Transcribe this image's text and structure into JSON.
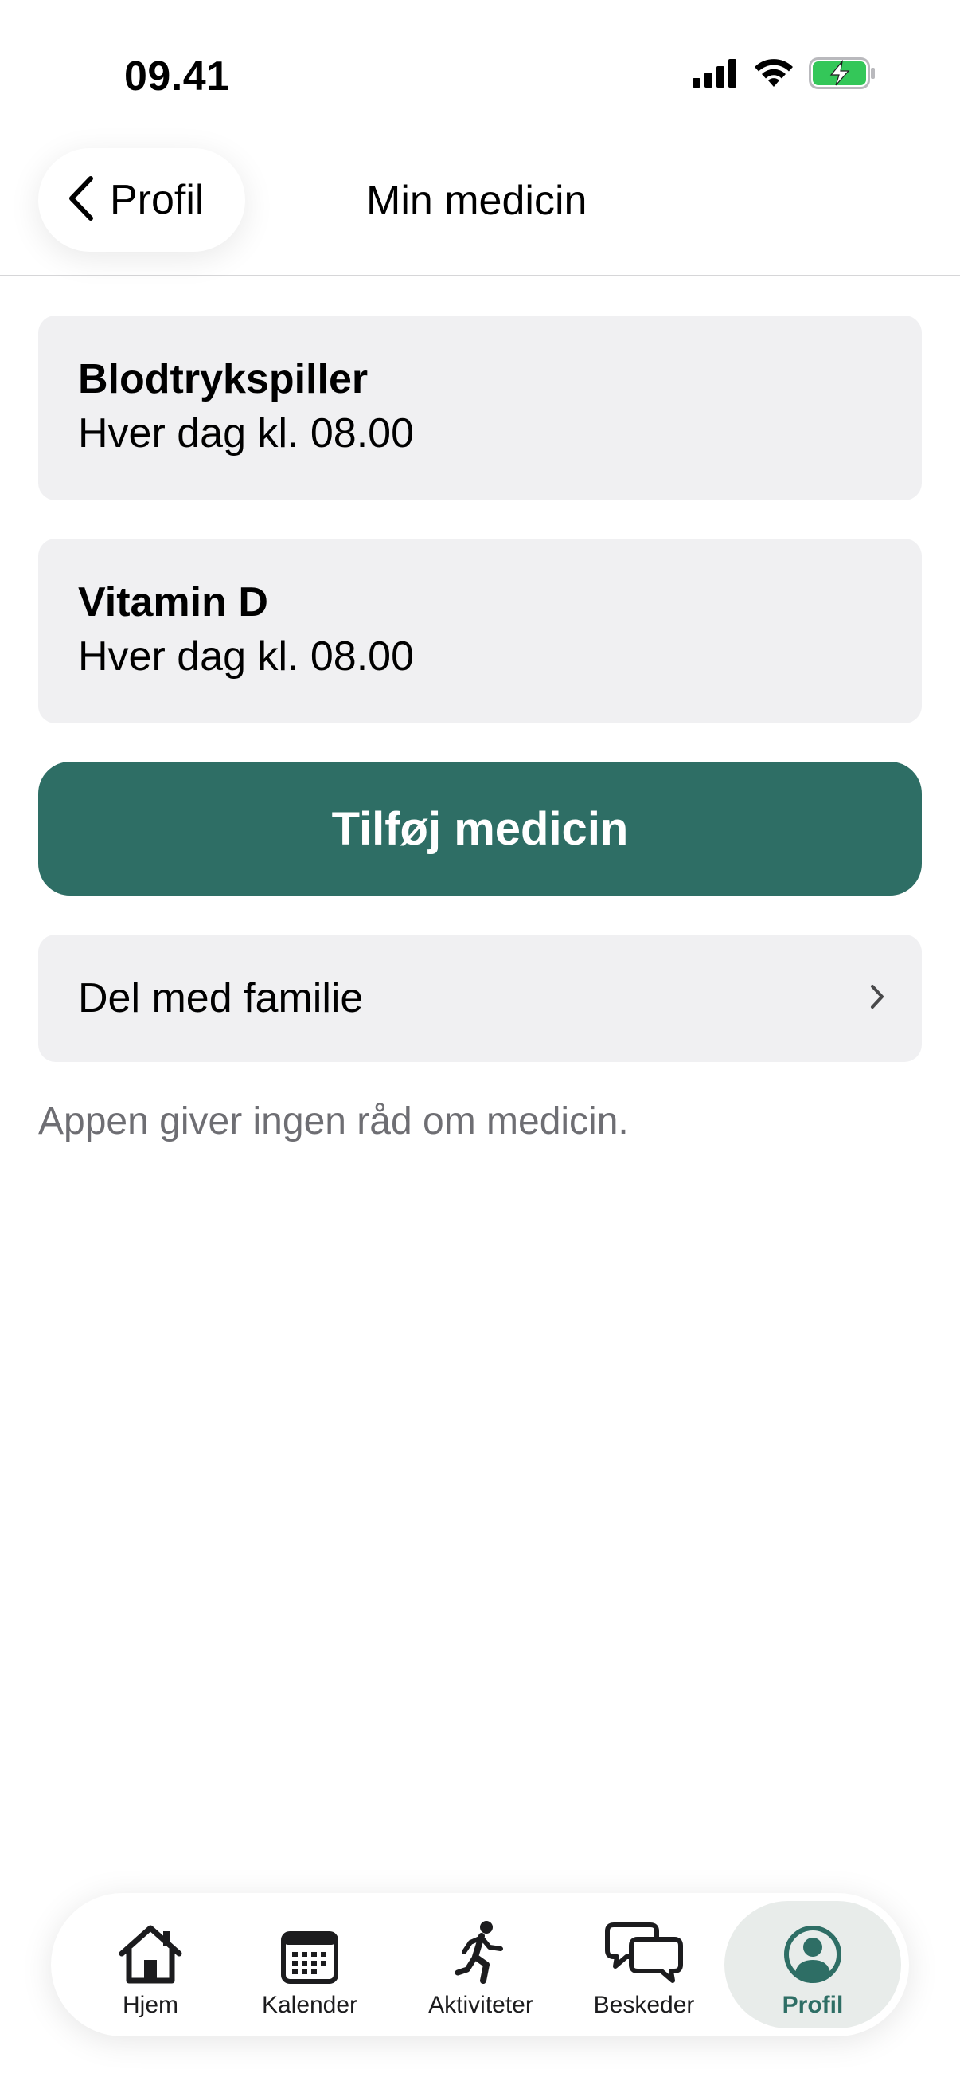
{
  "status_bar": {
    "time": "09.41",
    "icons": [
      "signal-icon",
      "wifi-icon",
      "battery-charging-icon"
    ],
    "battery_color": "#34c759"
  },
  "nav": {
    "back_label": "Profil",
    "title": "Min medicin"
  },
  "medicines": [
    {
      "name": "Blodtrykspiller",
      "schedule": "Hver dag kl. 08.00"
    },
    {
      "name": "Vitamin D",
      "schedule": "Hver dag kl. 08.00"
    }
  ],
  "add_button_label": "Tilføj medicin",
  "share_row": {
    "label": "Del med familie",
    "chevron": "›"
  },
  "disclaimer": "Appen giver ingen råd om medicin.",
  "tab_bar": {
    "active": "Profil",
    "tabs": [
      {
        "label": "Hjem",
        "icon": "house-icon"
      },
      {
        "label": "Kalender",
        "icon": "calendar-icon"
      },
      {
        "label": "Aktiviteter",
        "icon": "running-person-icon"
      },
      {
        "label": "Beskeder",
        "icon": "chat-bubbles-icon"
      },
      {
        "label": "Profil",
        "icon": "profile-icon"
      }
    ]
  },
  "colors": {
    "accent": "#2e6e65",
    "card_background": "#f0f0f2",
    "secondary_text": "#6e6e73"
  }
}
